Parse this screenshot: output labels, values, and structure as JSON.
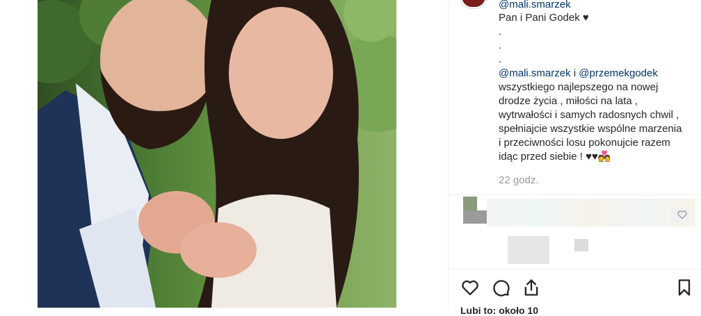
{
  "post": {
    "username": "@mali.smarzek",
    "caption_lines": [
      "Pan i Pani Godek ♥",
      ".",
      ".",
      "."
    ],
    "mention1": "@mali.smarzek",
    "conj": " i ",
    "mention2": "@przemekgodek",
    "body_lines": [
      "wszystkiego najlepszego na nowej",
      "drodze życia , miłości na lata ,",
      "wytrwałości i samych radosnych chwil ,",
      "spełniajcie wszystkie wspólne marzenia",
      "i przeciwności losu pokonujcie razem",
      "idąc przed siebie ! ♥♥💑"
    ],
    "time": "22 godz.",
    "likes_partial": "Lubi to: około 10"
  },
  "icons": {
    "like": "heart-icon",
    "comment": "comment-icon",
    "share": "share-icon",
    "save": "bookmark-icon"
  }
}
